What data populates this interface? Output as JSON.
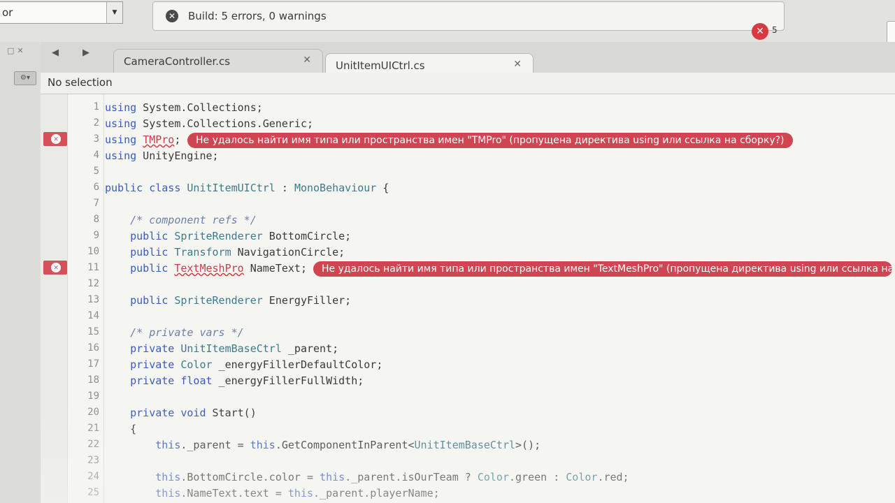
{
  "toolbar": {
    "config_value": "or",
    "status_text": "Build: 5 errors, 0 warnings",
    "error_count": "5",
    "icons": {
      "status": "build-status-icon",
      "error": "error-badge-icon",
      "dropdown": "chevron-down-icon"
    }
  },
  "tabs": [
    {
      "label": "CameraController.cs",
      "active": false
    },
    {
      "label": "UnitItemUICtrl.cs",
      "active": true
    }
  ],
  "breadcrumb": {
    "label": "No selection"
  },
  "editor": {
    "lines": [
      {
        "n": "1",
        "text": "using System.Collections;"
      },
      {
        "n": "2",
        "text": "using System.Collections.Generic;"
      },
      {
        "n": "3",
        "text": "using TMPro;",
        "error": true
      },
      {
        "n": "4",
        "text": "using UnityEngine;"
      },
      {
        "n": "5",
        "text": ""
      },
      {
        "n": "6",
        "text": "public class UnitItemUICtrl : MonoBehaviour {"
      },
      {
        "n": "7",
        "text": ""
      },
      {
        "n": "8",
        "text": "    /* component refs */"
      },
      {
        "n": "9",
        "text": "    public SpriteRenderer BottomCircle;"
      },
      {
        "n": "10",
        "text": "    public Transform NavigationCircle;"
      },
      {
        "n": "11",
        "text": "    public TextMeshPro NameText;",
        "error": true
      },
      {
        "n": "12",
        "text": ""
      },
      {
        "n": "13",
        "text": "    public SpriteRenderer EnergyFiller;"
      },
      {
        "n": "14",
        "text": ""
      },
      {
        "n": "15",
        "text": "    /* private vars */"
      },
      {
        "n": "16",
        "text": "    private UnitItemBaseCtrl _parent;"
      },
      {
        "n": "17",
        "text": "    private Color _energyFillerDefaultColor;"
      },
      {
        "n": "18",
        "text": "    private float _energyFillerFullWidth;"
      },
      {
        "n": "19",
        "text": ""
      },
      {
        "n": "20",
        "text": "    private void Start()"
      },
      {
        "n": "21",
        "text": "    {"
      },
      {
        "n": "22",
        "text": "        this._parent = this.GetComponentInParent<UnitItemBaseCtrl>();"
      },
      {
        "n": "23",
        "text": ""
      },
      {
        "n": "24",
        "text": "        this.BottomCircle.color = this._parent.isOurTeam ? Color.green : Color.red;"
      },
      {
        "n": "25",
        "text": "        this.NameText.text = this._parent.playerName;"
      }
    ],
    "errors": [
      {
        "line": "3",
        "message": "Не удалось найти имя типа или пространства имен \"TMPro\" (пропущена директива using или ссылка на сборку?)"
      },
      {
        "line": "11",
        "message": "Не удалось найти имя типа или пространства имен \"TextMeshPro\" (пропущена директива using или ссылка на сборку?)"
      }
    ]
  }
}
